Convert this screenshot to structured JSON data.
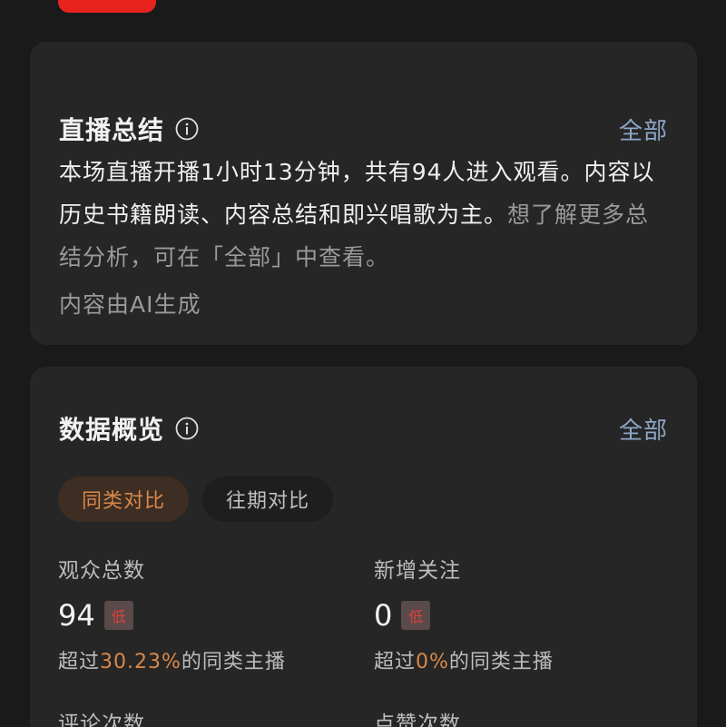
{
  "summary_card": {
    "title": "直播总结",
    "all_link": "全部",
    "body_main": "本场直播开播1小时13分钟，共有94人进入观看。内容以历史书籍朗读、内容总结和即兴唱歌为主。",
    "body_hint": "想了解更多总结分析，可在「全部」中查看。",
    "ai_note": "内容由AI生成"
  },
  "data_card": {
    "title": "数据概览",
    "all_link": "全部",
    "tabs": [
      {
        "label": "同类对比",
        "active": true
      },
      {
        "label": "往期对比",
        "active": false
      }
    ],
    "metrics": [
      {
        "label": "观众总数",
        "value": "94",
        "badge": "低",
        "sub_prefix": "超过",
        "sub_value": "30.23%",
        "sub_suffix": "的同类主播"
      },
      {
        "label": "新增关注",
        "value": "0",
        "badge": "低",
        "sub_prefix": "超过",
        "sub_value": "0%",
        "sub_suffix": "的同类主播"
      },
      {
        "label": "评论次数"
      },
      {
        "label": "点赞次数"
      }
    ]
  },
  "colors": {
    "background": "#1a1a1a",
    "card": "#262626",
    "link": "#8ea6c8",
    "accent_orange": "#d9894a",
    "badge_red": "#e0413b"
  },
  "icons": {
    "info": "info-icon"
  }
}
